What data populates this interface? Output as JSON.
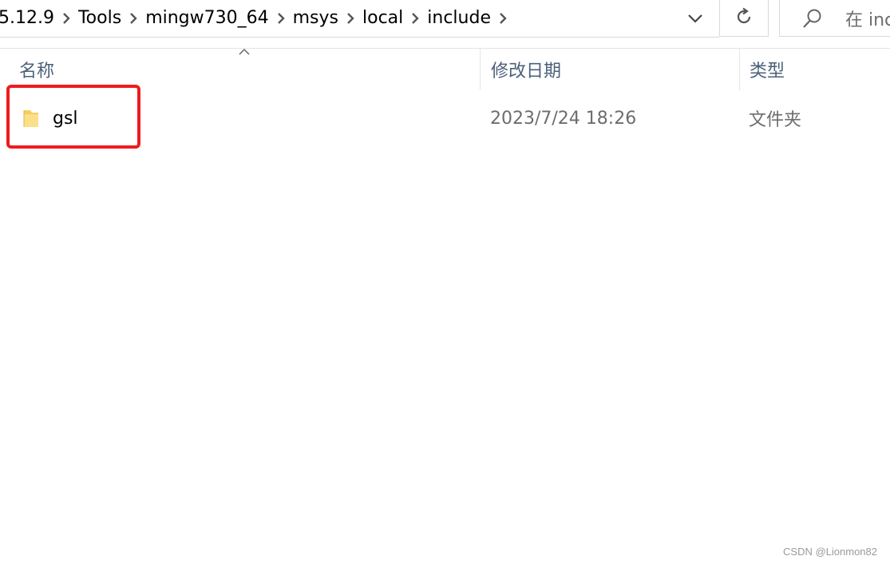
{
  "address_bar": {
    "breadcrumbs": [
      "5.12.9",
      "Tools",
      "mingw730_64",
      "msys",
      "local",
      "include"
    ]
  },
  "search": {
    "placeholder": "在 inc"
  },
  "columns": {
    "name": "名称",
    "date_modified": "修改日期",
    "type": "类型"
  },
  "files": [
    {
      "name": "gsl",
      "date_modified": "2023/7/24 18:26",
      "type": "文件夹"
    }
  ],
  "icons": {
    "separator": "chevron-right-icon",
    "dropdown": "chevron-down-icon",
    "refresh": "refresh-icon",
    "search": "search-icon",
    "folder": "folder-icon",
    "sort": "sort-up-icon"
  },
  "colors": {
    "highlight": "#ee1c1c",
    "header_text": "#4c607a",
    "folder": "#f4cf5e"
  },
  "watermark": "CSDN @Lionmon82"
}
